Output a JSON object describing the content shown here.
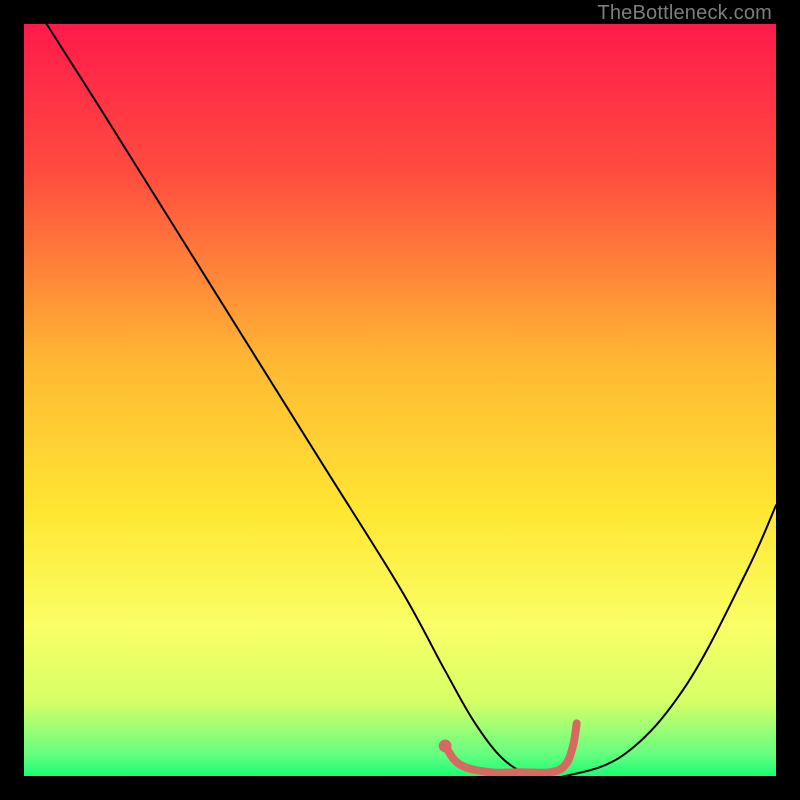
{
  "watermark": "TheBottleneck.com",
  "chart_data": {
    "type": "line",
    "title": "",
    "xlabel": "",
    "ylabel": "",
    "xlim": [
      0,
      100
    ],
    "ylim": [
      0,
      100
    ],
    "gradient_stops": [
      {
        "offset": 0,
        "color": "#ff1a4b"
      },
      {
        "offset": 20,
        "color": "#ff4d3f"
      },
      {
        "offset": 45,
        "color": "#ffb833"
      },
      {
        "offset": 65,
        "color": "#ffe733"
      },
      {
        "offset": 80,
        "color": "#faff66"
      },
      {
        "offset": 90,
        "color": "#d7ff66"
      },
      {
        "offset": 97,
        "color": "#66ff80"
      },
      {
        "offset": 100,
        "color": "#1aff73"
      }
    ],
    "series": [
      {
        "name": "bottleneck-curve",
        "stroke": "#000000",
        "stroke_width": 2,
        "x": [
          3,
          10,
          20,
          30,
          40,
          50,
          56,
          60,
          64,
          68,
          72,
          80,
          88,
          96,
          100
        ],
        "y": [
          100,
          89,
          73,
          57,
          41,
          25,
          14,
          7,
          2,
          0,
          0,
          3,
          12,
          27,
          36
        ]
      },
      {
        "name": "optimal-marker",
        "stroke": "#d66a63",
        "stroke_width": 8,
        "x": [
          56,
          58,
          62,
          66,
          70,
          72,
          73,
          73.5
        ],
        "y": [
          4,
          1.5,
          0.5,
          0.5,
          0.5,
          1.5,
          4,
          7
        ]
      }
    ],
    "marker_dot": {
      "x": 56,
      "y": 4,
      "r": 3.2,
      "color": "#d66a63"
    }
  }
}
